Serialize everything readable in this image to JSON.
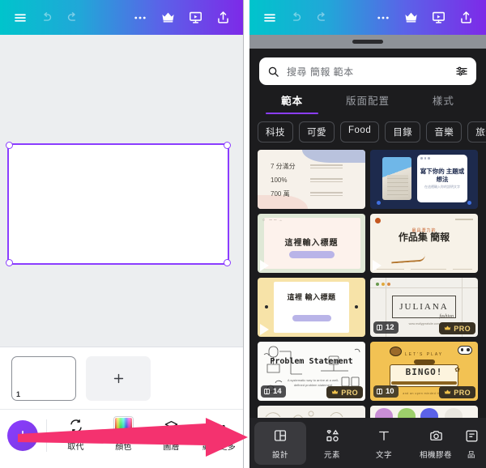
{
  "editor": {
    "header": {
      "menu_icon": "hamburger-menu-icon",
      "undo_icon": "undo-icon",
      "redo_icon": "redo-icon",
      "more_icon": "more-horizontal-icon",
      "crown_icon": "crown-icon",
      "present_icon": "present-icon",
      "share_icon": "share-upload-icon"
    },
    "canvas": {
      "selection_color": "#8b3dff",
      "background": "#ffffff"
    },
    "pages": {
      "page_number": "1",
      "add_page_icon": "plus-icon"
    },
    "toolbar": {
      "add_button_icon": "plus-icon",
      "items": [
        {
          "label": "取代",
          "icon": "replace-icon"
        },
        {
          "label": "顏色",
          "icon": "color-swatch-icon"
        },
        {
          "label": "圖層",
          "icon": "layers-icon"
        },
        {
          "label": "顯示更多",
          "icon": "more-horizontal-icon"
        }
      ]
    }
  },
  "panel": {
    "header": {
      "menu_icon": "hamburger-menu-icon",
      "undo_icon": "undo-icon",
      "redo_icon": "redo-icon",
      "more_icon": "more-horizontal-icon",
      "crown_icon": "crown-icon",
      "present_icon": "present-icon",
      "share_icon": "share-upload-icon"
    },
    "search": {
      "placeholder": "搜尋 簡報 範本",
      "search_icon": "search-icon",
      "filter_icon": "sliders-filter-icon"
    },
    "tabs": [
      {
        "label": "範本",
        "active": true
      },
      {
        "label": "版面配置",
        "active": false
      },
      {
        "label": "樣式",
        "active": false
      }
    ],
    "chips": [
      "科技",
      "可愛",
      "Food",
      "目錄",
      "音樂",
      "旅遊"
    ],
    "accent": "#8b3dff",
    "templates": [
      {
        "name": "stats-template",
        "stats": [
          "7 分滿分",
          "100%",
          "700 萬"
        ],
        "has_play": false,
        "pages": null,
        "pro": false
      },
      {
        "name": "navy-photo-template",
        "title": "寫下你的\n主題或想法",
        "subtitle": "在這裡輸入你的說明文字",
        "has_play": false,
        "pages": null,
        "pro": false
      },
      {
        "name": "green-title-template",
        "title": "這裡輸入標題",
        "eyebrow": "○ ──→",
        "has_play": true,
        "pages": null,
        "pro": false
      },
      {
        "name": "portfolio-template",
        "eyebrow": "最具潛力的",
        "title": "作品集\n簡報",
        "has_play": true,
        "pages": null,
        "pro": false
      },
      {
        "name": "yellow-title-template",
        "title": "這裡\n輸入標題",
        "has_play": true,
        "pages": null,
        "pro": false
      },
      {
        "name": "juliana-template",
        "title": "JULIANA",
        "subtitle": "fashion",
        "footnote": "www.reallygreatsite.com",
        "has_play": false,
        "pages": "12",
        "pro": true
      },
      {
        "name": "problem-statement-template",
        "title": "Problem\nStatement",
        "subtitle": "A systematic way to arrive at a well-defined problem statement",
        "has_play": false,
        "pages": "14",
        "pro": true
      },
      {
        "name": "bingo-template",
        "eyebrow": "LET'S PLAY",
        "title": "BINGO!",
        "footnote": "and an open minded thing",
        "has_play": false,
        "pages": "10",
        "pro": true
      },
      {
        "name": "partial-template-left",
        "has_play": false,
        "pages": null,
        "pro": false
      },
      {
        "name": "partial-template-right",
        "has_play": false,
        "pages": null,
        "pro": false
      }
    ],
    "pro_label": "PRO",
    "bottom_nav": [
      {
        "label": "設計",
        "icon": "design-layout-icon",
        "active": true
      },
      {
        "label": "元素",
        "icon": "elements-shapes-icon",
        "active": false
      },
      {
        "label": "文字",
        "icon": "text-t-icon",
        "active": false
      },
      {
        "label": "相機膠卷",
        "icon": "camera-roll-icon",
        "active": false
      },
      {
        "label": "品",
        "icon": "brand-kit-icon",
        "active": false
      }
    ]
  },
  "annotation": {
    "arrow_color": "#f4326f",
    "name": "pink-pointer-arrow"
  }
}
